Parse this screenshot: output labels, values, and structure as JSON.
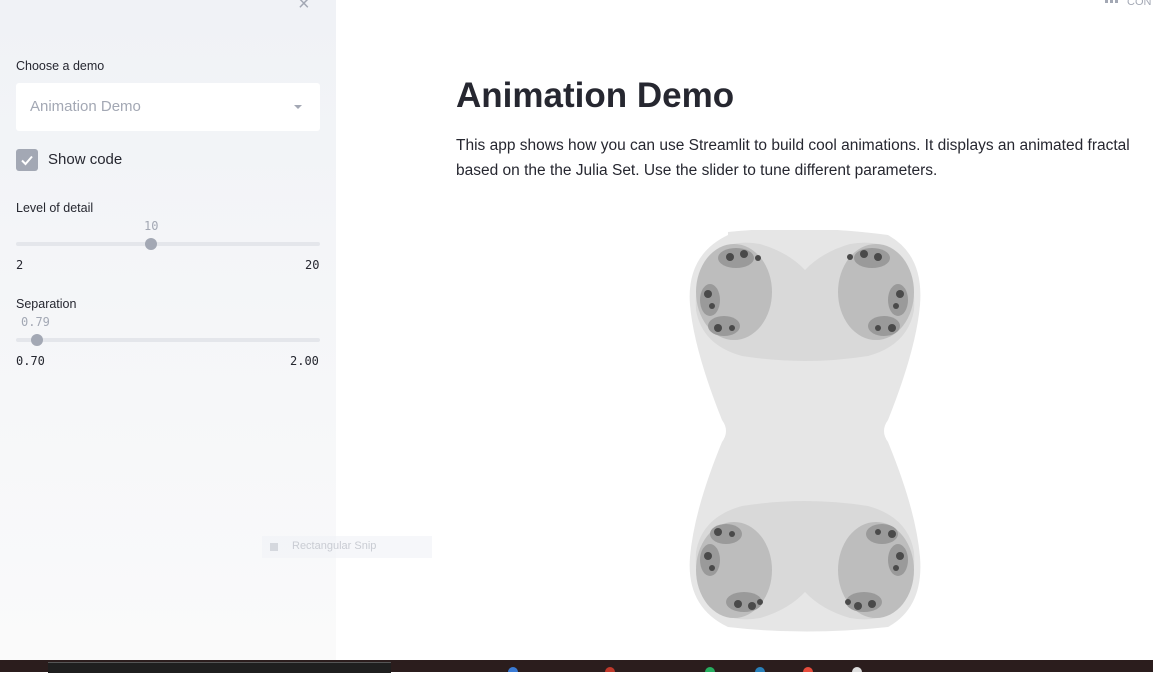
{
  "sidebar": {
    "close_glyph": "×",
    "demo_label": "Choose a demo",
    "demo_value": "Animation Demo",
    "show_code_label": "Show code",
    "show_code_checked": true,
    "detail": {
      "label": "Level of detail",
      "value": "10",
      "min": "2",
      "max": "20"
    },
    "separation": {
      "label": "Separation",
      "value": "0.79",
      "min": "0.70",
      "max": "2.00"
    },
    "ghost_text": "Rectangular Snip"
  },
  "header": {
    "menu_text": "CON"
  },
  "main": {
    "title": "Animation Demo",
    "description": "This app shows how you can use Streamlit to build cool animations. It displays an animated fractal based on the the Julia Set. Use the slider to tune different parameters."
  },
  "colors": {
    "sidebar_bg": "#f0f2f6",
    "accent": "#a3a8b4",
    "text": "#262730"
  },
  "icons": [
    "close-icon",
    "chevron-down-icon",
    "check-icon",
    "menu-icon"
  ]
}
